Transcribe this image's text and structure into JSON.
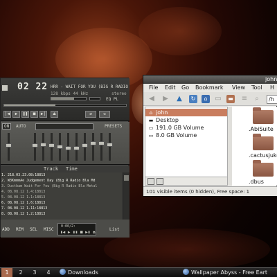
{
  "player": {
    "time": "02 22",
    "song_title": "HRR - WAIT FOR YOU (BIG R RADIO",
    "bitrate": "128",
    "bitrate_unit": "kbps",
    "samplerate": "44",
    "samplerate_unit": "kHz",
    "stereo": "stereo",
    "eq_pl": "EQ  PL",
    "volume_level": 0.65,
    "seek_progress": 0.42,
    "controls": [
      "|◀",
      "▶",
      "❚❚",
      "■",
      "▶|",
      "⏏"
    ],
    "extra_controls": [
      "⇄",
      "↻"
    ],
    "eq": {
      "on_label": "ON",
      "auto_label": "AUTO",
      "presets_label": "PRESETS",
      "preamp_level": 0.55,
      "bands": [
        0.55,
        0.6,
        0.55,
        0.5,
        0.45,
        0.45,
        0.55,
        0.65,
        0.65,
        0.6
      ]
    },
    "playlist": {
      "col_track": "Track",
      "col_time": "Time",
      "items": [
        "1. 218.03.23.08:18813",
        "2. W3KmmmAe    Judgement Day (Big R Radio   Bla Md",
        "3. Dustbam   Wait For You (Big R Radio   Bla Metal",
        "4. 08.08.12 1.4:18813",
        "5. 08.08.12 1.1:18813",
        "6. 08.08.12 1.6:18813",
        "7. 08.08.12 1.11:18813",
        "8. 08.08.12 1.2:18813"
      ],
      "buttons": {
        "add": "ADD",
        "rem": "REM",
        "sel": "SEL",
        "misc": "MISC",
        "list": "List"
      },
      "mini_time": "0:00/2:",
      "mini_controls": "▮◀ ▶ ▮▮ ■ ▶▮ ⏏"
    }
  },
  "file_manager": {
    "title": "john",
    "menu": [
      "File",
      "Edit",
      "Go",
      "Bookmark",
      "View",
      "Tool",
      "H"
    ],
    "location": "/h",
    "sidebar": [
      {
        "label": "john",
        "icon": "home-icon"
      },
      {
        "label": "Desktop",
        "icon": "desktop-icon"
      },
      {
        "label": "191.0 GB Volume",
        "icon": "drive-icon"
      },
      {
        "label": "8.0 GB Volume",
        "icon": "drive-icon"
      }
    ],
    "files": [
      ".AbiSuite",
      ".cactusjukebo",
      ".dbus"
    ],
    "status": "101 visible items (0 hidden), Free space: 1"
  },
  "taskbar": {
    "workspaces": [
      "1",
      "2",
      "3",
      "4"
    ],
    "active_workspace": "1",
    "tasks": [
      "Downloads",
      "Wallpaper Abyss - Free Eart"
    ]
  }
}
